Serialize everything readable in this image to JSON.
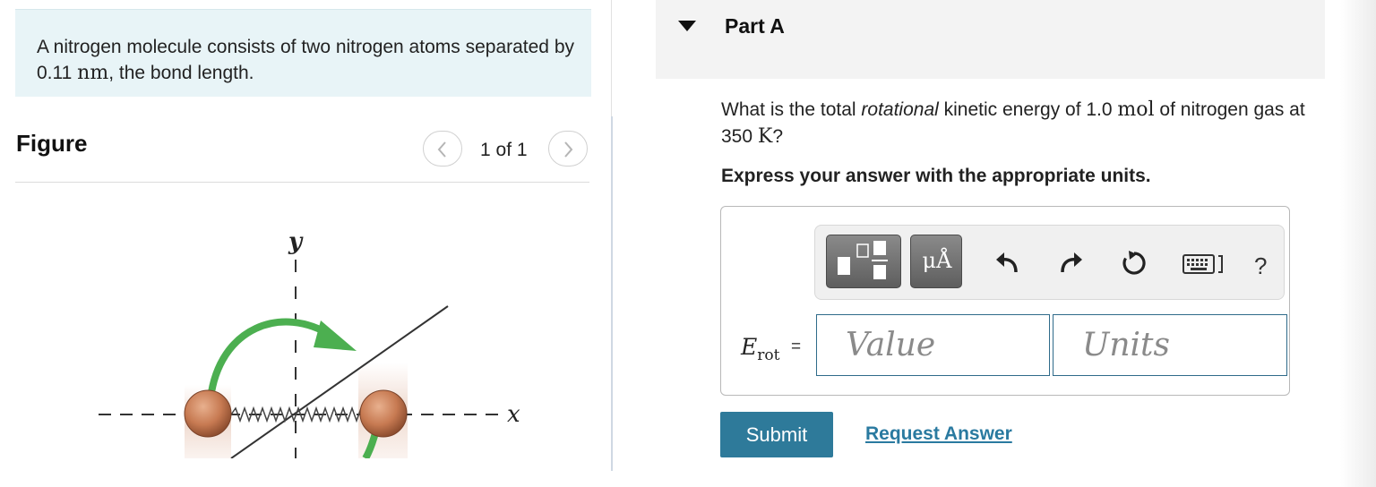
{
  "problem": {
    "text_before": "A nitrogen molecule consists of two nitrogen atoms separated by 0.11 ",
    "unit": "nm",
    "text_after": ", the bond length."
  },
  "figure": {
    "title": "Figure",
    "pager": "1 of 1",
    "axis_y_label": "y",
    "axis_x_label": "x"
  },
  "part": {
    "title": "Part A"
  },
  "question": {
    "text_1": "What is the total ",
    "emphasis": "rotational",
    "text_2": " kinetic energy of 1.0 ",
    "unit_1": "mol",
    "text_3": " of nitrogen gas at 350 ",
    "unit_2": "K",
    "text_4": "?"
  },
  "instruction": "Express your answer with the appropriate units.",
  "answer": {
    "label_main": "E",
    "label_sub": "rot",
    "equals": "=",
    "value_placeholder": "Value",
    "units_placeholder": "Units"
  },
  "toolbar": {
    "units_button": "μÅ",
    "help": "?"
  },
  "actions": {
    "submit": "Submit",
    "request_answer": "Request Answer"
  }
}
